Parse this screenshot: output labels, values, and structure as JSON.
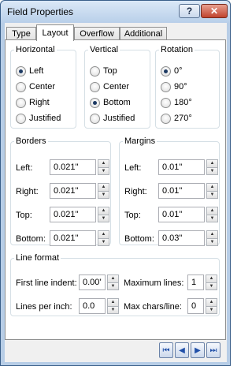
{
  "window": {
    "title": "Field Properties",
    "help_glyph": "?",
    "close_glyph": "✕"
  },
  "tabs": [
    {
      "label": "Type"
    },
    {
      "label": "Layout",
      "active": true
    },
    {
      "label": "Overflow"
    },
    {
      "label": "Additional"
    }
  ],
  "horizontal": {
    "title": "Horizontal",
    "options": [
      {
        "label": "Left",
        "checked": true
      },
      {
        "label": "Center",
        "checked": false
      },
      {
        "label": "Right",
        "checked": false
      },
      {
        "label": "Justified",
        "checked": false
      }
    ]
  },
  "vertical": {
    "title": "Vertical",
    "options": [
      {
        "label": "Top",
        "checked": false
      },
      {
        "label": "Center",
        "checked": false
      },
      {
        "label": "Bottom",
        "checked": true
      },
      {
        "label": "Justified",
        "checked": false
      }
    ]
  },
  "rotation": {
    "title": "Rotation",
    "options": [
      {
        "label": "0°",
        "checked": true
      },
      {
        "label": "90°",
        "checked": false
      },
      {
        "label": "180°",
        "checked": false
      },
      {
        "label": "270°",
        "checked": false
      }
    ]
  },
  "borders": {
    "title": "Borders",
    "fields": [
      {
        "label": "Left:",
        "value": "0.021\""
      },
      {
        "label": "Right:",
        "value": "0.021\""
      },
      {
        "label": "Top:",
        "value": "0.021\""
      },
      {
        "label": "Bottom:",
        "value": "0.021\""
      }
    ]
  },
  "margins": {
    "title": "Margins",
    "fields": [
      {
        "label": "Left:",
        "value": "0.01\""
      },
      {
        "label": "Right:",
        "value": "0.01\""
      },
      {
        "label": "Top:",
        "value": "0.01\""
      },
      {
        "label": "Bottom:",
        "value": "0.03\""
      }
    ]
  },
  "line_format": {
    "title": "Line format",
    "first_line_indent": {
      "label": "First line indent:",
      "value": "0.00\""
    },
    "maximum_lines": {
      "label": "Maximum lines:",
      "value": "1"
    },
    "lines_per_inch": {
      "label": "Lines per inch:",
      "value": "0.0"
    },
    "max_chars_line": {
      "label": "Max chars/line:",
      "value": "0"
    }
  },
  "navigation": {
    "first_glyph": "⏮",
    "prev_glyph": "◀",
    "next_glyph": "▶",
    "last_glyph": "⏭"
  },
  "colors": {
    "title_bar": "#b8cfe9",
    "close_button": "#c0432e",
    "selected_radio": "#1d3a63",
    "nav_arrow": "#1f4fa8"
  }
}
